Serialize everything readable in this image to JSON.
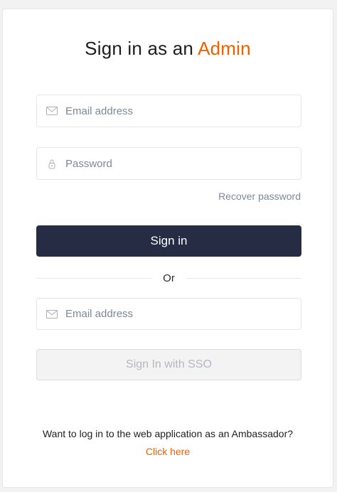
{
  "header": {
    "title_prefix": "Sign in as an",
    "title_accent": "Admin"
  },
  "login_form": {
    "email_placeholder": "Email address",
    "password_placeholder": "Password",
    "recover_label": "Recover password",
    "signin_label": "Sign in"
  },
  "divider": {
    "label": "Or"
  },
  "sso_form": {
    "email_placeholder": "Email address",
    "sso_label": "Sign In with SSO"
  },
  "footer": {
    "prompt": "Want to log in to the web application as an Ambassador?",
    "link_label": "Click here"
  },
  "icons": {
    "email": "envelope-icon",
    "password": "lock-icon"
  },
  "colors": {
    "accent": "#f06000",
    "primary_button": "#252c44",
    "disabled_button": "#f3f3f3"
  }
}
